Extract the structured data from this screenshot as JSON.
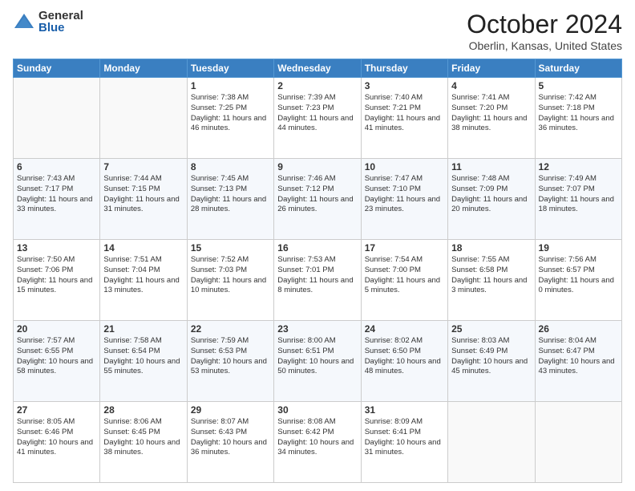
{
  "logo": {
    "general": "General",
    "blue": "Blue"
  },
  "header": {
    "title": "October 2024",
    "subtitle": "Oberlin, Kansas, United States"
  },
  "days_of_week": [
    "Sunday",
    "Monday",
    "Tuesday",
    "Wednesday",
    "Thursday",
    "Friday",
    "Saturday"
  ],
  "weeks": [
    [
      {
        "day": "",
        "content": ""
      },
      {
        "day": "",
        "content": ""
      },
      {
        "day": "1",
        "content": "Sunrise: 7:38 AM\nSunset: 7:25 PM\nDaylight: 11 hours and 46 minutes."
      },
      {
        "day": "2",
        "content": "Sunrise: 7:39 AM\nSunset: 7:23 PM\nDaylight: 11 hours and 44 minutes."
      },
      {
        "day": "3",
        "content": "Sunrise: 7:40 AM\nSunset: 7:21 PM\nDaylight: 11 hours and 41 minutes."
      },
      {
        "day": "4",
        "content": "Sunrise: 7:41 AM\nSunset: 7:20 PM\nDaylight: 11 hours and 38 minutes."
      },
      {
        "day": "5",
        "content": "Sunrise: 7:42 AM\nSunset: 7:18 PM\nDaylight: 11 hours and 36 minutes."
      }
    ],
    [
      {
        "day": "6",
        "content": "Sunrise: 7:43 AM\nSunset: 7:17 PM\nDaylight: 11 hours and 33 minutes."
      },
      {
        "day": "7",
        "content": "Sunrise: 7:44 AM\nSunset: 7:15 PM\nDaylight: 11 hours and 31 minutes."
      },
      {
        "day": "8",
        "content": "Sunrise: 7:45 AM\nSunset: 7:13 PM\nDaylight: 11 hours and 28 minutes."
      },
      {
        "day": "9",
        "content": "Sunrise: 7:46 AM\nSunset: 7:12 PM\nDaylight: 11 hours and 26 minutes."
      },
      {
        "day": "10",
        "content": "Sunrise: 7:47 AM\nSunset: 7:10 PM\nDaylight: 11 hours and 23 minutes."
      },
      {
        "day": "11",
        "content": "Sunrise: 7:48 AM\nSunset: 7:09 PM\nDaylight: 11 hours and 20 minutes."
      },
      {
        "day": "12",
        "content": "Sunrise: 7:49 AM\nSunset: 7:07 PM\nDaylight: 11 hours and 18 minutes."
      }
    ],
    [
      {
        "day": "13",
        "content": "Sunrise: 7:50 AM\nSunset: 7:06 PM\nDaylight: 11 hours and 15 minutes."
      },
      {
        "day": "14",
        "content": "Sunrise: 7:51 AM\nSunset: 7:04 PM\nDaylight: 11 hours and 13 minutes."
      },
      {
        "day": "15",
        "content": "Sunrise: 7:52 AM\nSunset: 7:03 PM\nDaylight: 11 hours and 10 minutes."
      },
      {
        "day": "16",
        "content": "Sunrise: 7:53 AM\nSunset: 7:01 PM\nDaylight: 11 hours and 8 minutes."
      },
      {
        "day": "17",
        "content": "Sunrise: 7:54 AM\nSunset: 7:00 PM\nDaylight: 11 hours and 5 minutes."
      },
      {
        "day": "18",
        "content": "Sunrise: 7:55 AM\nSunset: 6:58 PM\nDaylight: 11 hours and 3 minutes."
      },
      {
        "day": "19",
        "content": "Sunrise: 7:56 AM\nSunset: 6:57 PM\nDaylight: 11 hours and 0 minutes."
      }
    ],
    [
      {
        "day": "20",
        "content": "Sunrise: 7:57 AM\nSunset: 6:55 PM\nDaylight: 10 hours and 58 minutes."
      },
      {
        "day": "21",
        "content": "Sunrise: 7:58 AM\nSunset: 6:54 PM\nDaylight: 10 hours and 55 minutes."
      },
      {
        "day": "22",
        "content": "Sunrise: 7:59 AM\nSunset: 6:53 PM\nDaylight: 10 hours and 53 minutes."
      },
      {
        "day": "23",
        "content": "Sunrise: 8:00 AM\nSunset: 6:51 PM\nDaylight: 10 hours and 50 minutes."
      },
      {
        "day": "24",
        "content": "Sunrise: 8:02 AM\nSunset: 6:50 PM\nDaylight: 10 hours and 48 minutes."
      },
      {
        "day": "25",
        "content": "Sunrise: 8:03 AM\nSunset: 6:49 PM\nDaylight: 10 hours and 45 minutes."
      },
      {
        "day": "26",
        "content": "Sunrise: 8:04 AM\nSunset: 6:47 PM\nDaylight: 10 hours and 43 minutes."
      }
    ],
    [
      {
        "day": "27",
        "content": "Sunrise: 8:05 AM\nSunset: 6:46 PM\nDaylight: 10 hours and 41 minutes."
      },
      {
        "day": "28",
        "content": "Sunrise: 8:06 AM\nSunset: 6:45 PM\nDaylight: 10 hours and 38 minutes."
      },
      {
        "day": "29",
        "content": "Sunrise: 8:07 AM\nSunset: 6:43 PM\nDaylight: 10 hours and 36 minutes."
      },
      {
        "day": "30",
        "content": "Sunrise: 8:08 AM\nSunset: 6:42 PM\nDaylight: 10 hours and 34 minutes."
      },
      {
        "day": "31",
        "content": "Sunrise: 8:09 AM\nSunset: 6:41 PM\nDaylight: 10 hours and 31 minutes."
      },
      {
        "day": "",
        "content": ""
      },
      {
        "day": "",
        "content": ""
      }
    ]
  ]
}
